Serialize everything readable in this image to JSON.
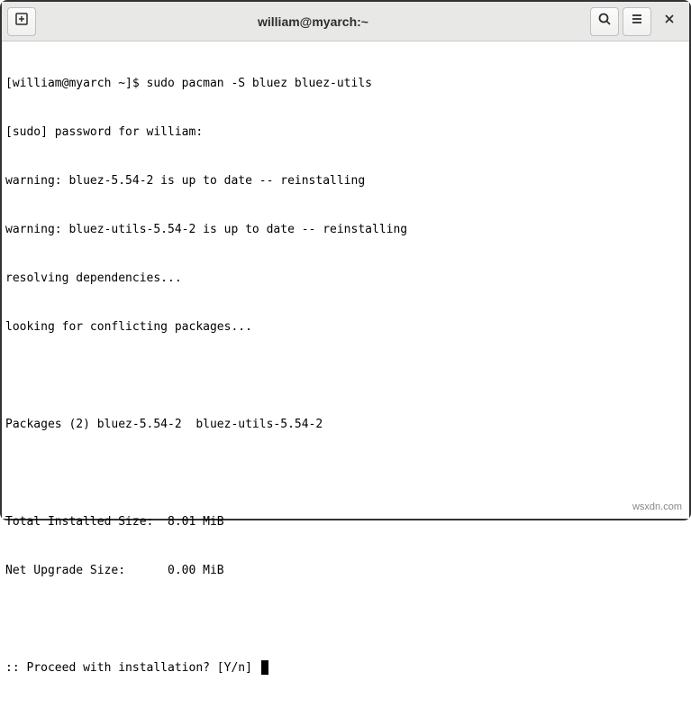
{
  "titlebar": {
    "title": "william@myarch:~"
  },
  "terminal": {
    "lines": [
      "[william@myarch ~]$ sudo pacman -S bluez bluez-utils",
      "[sudo] password for william:",
      "warning: bluez-5.54-2 is up to date -- reinstalling",
      "warning: bluez-utils-5.54-2 is up to date -- reinstalling",
      "resolving dependencies...",
      "looking for conflicting packages...",
      "",
      "Packages (2) bluez-5.54-2  bluez-utils-5.54-2",
      "",
      "Total Installed Size:  8.01 MiB",
      "Net Upgrade Size:      0.00 MiB",
      "",
      ":: Proceed with installation? [Y/n] "
    ]
  },
  "watermark": "wsxdn.com"
}
